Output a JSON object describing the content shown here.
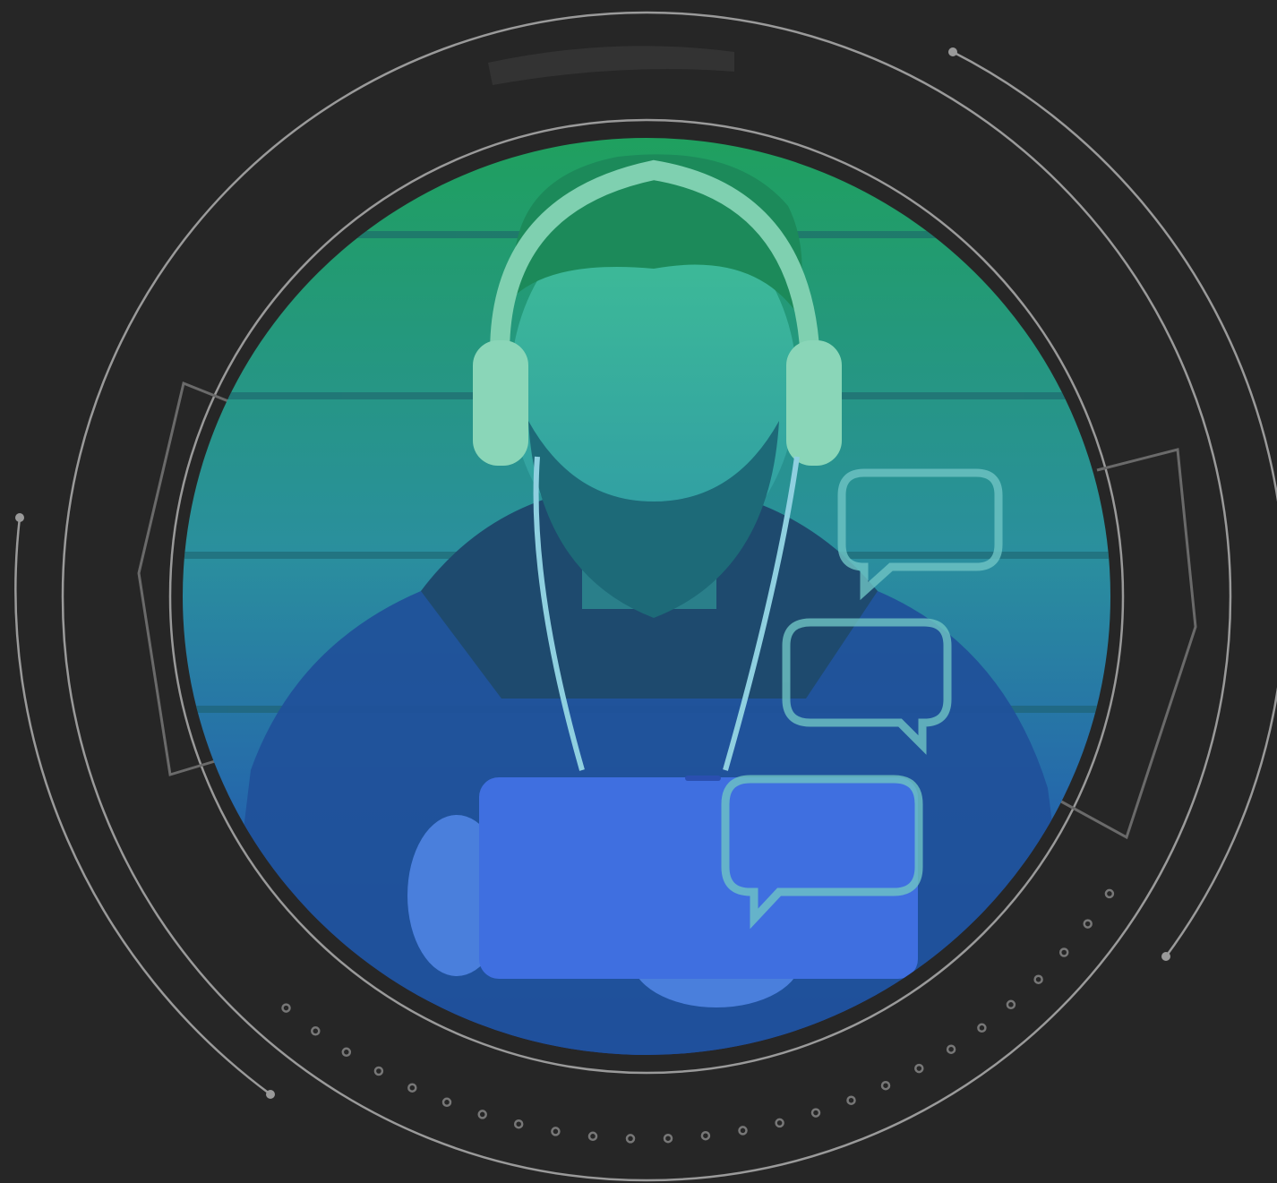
{
  "colors": {
    "background": "#262626",
    "ring": "#9a9a9a",
    "ring_faint": "#5a5a5a",
    "gradient_top": "#1fa05e",
    "gradient_mid": "#2a8aa0",
    "gradient_bottom": "#1f3fb8",
    "bubble_stroke": "#6fc4c4"
  },
  "image": {
    "subject": "man-with-headphones-using-tablet",
    "icons": [
      "chat-bubble-icon",
      "chat-bubble-icon",
      "chat-bubble-icon"
    ]
  },
  "decorations": {
    "dot_count": 26
  }
}
